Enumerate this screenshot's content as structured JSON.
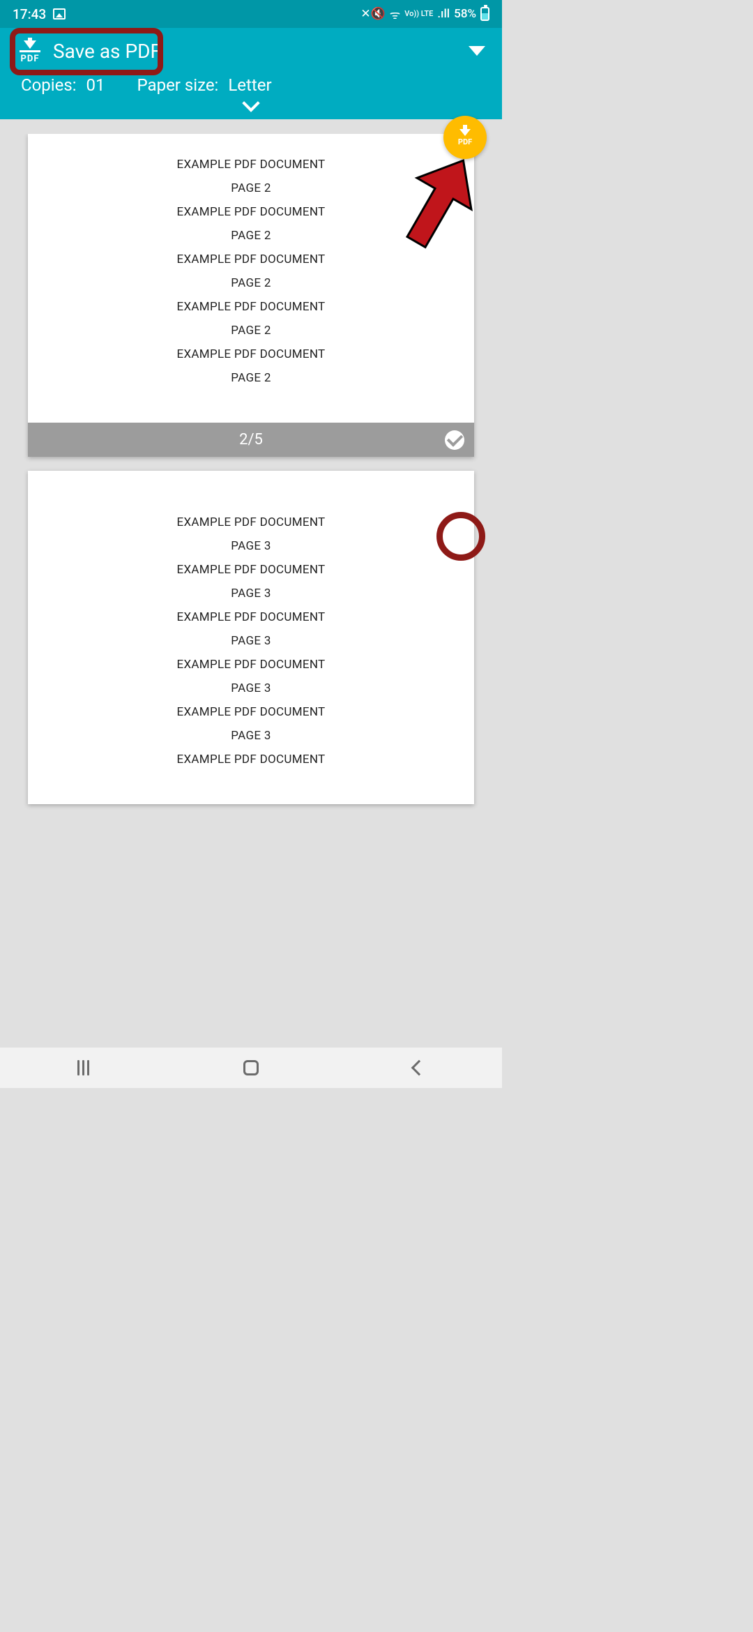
{
  "status": {
    "time": "17:43",
    "net": "Vo)) LTE",
    "signal": ".ıll",
    "battery_pct": "58%"
  },
  "header": {
    "save_label": "Save as PDF",
    "pdf_icon_label": "PDF",
    "copies_label": "Copies:",
    "copies_value": "01",
    "paper_size_label": "Paper size:",
    "paper_size_value": "Letter"
  },
  "fab": {
    "label": "PDF"
  },
  "pages": {
    "page2_counter": "2/5",
    "page2_lines": [
      "EXAMPLE PDF DOCUMENT",
      "PAGE 2",
      "EXAMPLE PDF DOCUMENT",
      "PAGE 2",
      "EXAMPLE PDF DOCUMENT",
      "PAGE 2",
      "EXAMPLE PDF DOCUMENT",
      "PAGE 2",
      "EXAMPLE PDF DOCUMENT",
      "PAGE 2"
    ],
    "page3_lines": [
      "EXAMPLE PDF DOCUMENT",
      "PAGE 3",
      "EXAMPLE PDF DOCUMENT",
      "PAGE 3",
      "EXAMPLE PDF DOCUMENT",
      "PAGE 3",
      "EXAMPLE PDF DOCUMENT",
      "PAGE 3",
      "EXAMPLE PDF DOCUMENT",
      "PAGE 3",
      "EXAMPLE PDF DOCUMENT"
    ]
  },
  "annotations": {
    "highlight_save": true,
    "arrow_to_fab": true,
    "circle_check": true
  }
}
